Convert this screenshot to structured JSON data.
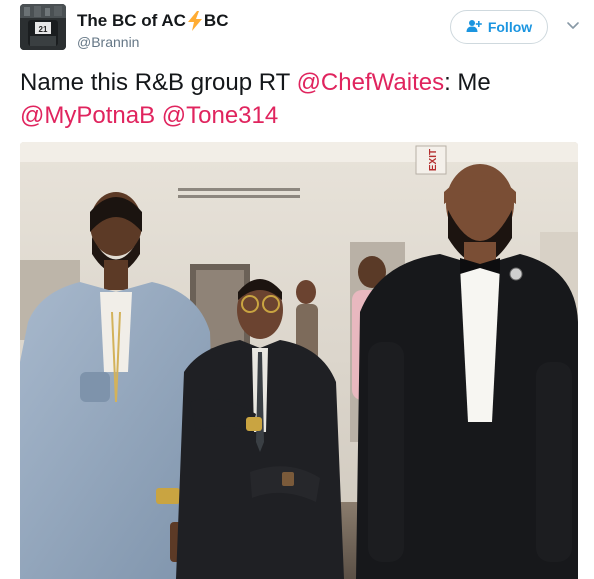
{
  "header": {
    "name_part1": "The BC of AC",
    "name_part2": "BC",
    "handle": "@Brannin",
    "follow_label": "Follow"
  },
  "tweet": {
    "text_1": "Name this R&B group RT ",
    "mention_1": "@ChefWaites",
    "text_2": ": Me ",
    "mention_2": "@MyPotnaB",
    "text_3": " ",
    "mention_3": "@Tone314"
  },
  "photo": {
    "exit_sign": "EXIT"
  },
  "icons": {
    "follow": "add-person-icon",
    "menu": "chevron-down-icon",
    "bolt": "lightning-bolt-emoji"
  },
  "colors": {
    "link": "#e0245e",
    "follow": "#1b95e0",
    "text": "#14171a",
    "muted": "#657786",
    "bolt": "#ffac33"
  }
}
